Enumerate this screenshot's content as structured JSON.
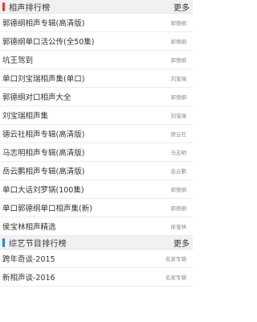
{
  "sections": [
    {
      "title": "相声排行榜",
      "more_label": "更多",
      "accent_color": "#e53935",
      "items": [
        {
          "title": "郭德纲相声专辑(高清版)",
          "artist": "郭德纲"
        },
        {
          "title": "郭德纲单口活公传(全50集)",
          "artist": "郭德纲"
        },
        {
          "title": "坑王驾到",
          "artist": "郭德纲"
        },
        {
          "title": "单口刘宝瑞相声集(单口)",
          "artist": "刘宝瑞"
        },
        {
          "title": "郭德纲对口相声大全",
          "artist": "郭德纲"
        },
        {
          "title": "刘宝瑞相声集",
          "artist": "刘宝瑞"
        },
        {
          "title": "德云社相声专辑(高清版)",
          "artist": "德云社"
        },
        {
          "title": "马志明相声专辑(高清版)",
          "artist": "马志明"
        },
        {
          "title": "岳云鹏相声专辑(高清版)",
          "artist": "岳云鹏"
        },
        {
          "title": "单口大话刘罗锅(100集)",
          "artist": "郭德纲"
        },
        {
          "title": "单口郭德纲单口相声集(新)",
          "artist": "郭德纲"
        },
        {
          "title": "侯宝林相声精选",
          "artist": "侯宝林"
        }
      ]
    },
    {
      "title": "综艺节目排行榜",
      "more_label": "更多",
      "accent_color": "#1e88e5",
      "items": [
        {
          "title": "跨年奇谈-2015",
          "artist": "名家专辑"
        },
        {
          "title": "新相声谈-2016",
          "artist": "名家专辑"
        }
      ]
    }
  ]
}
